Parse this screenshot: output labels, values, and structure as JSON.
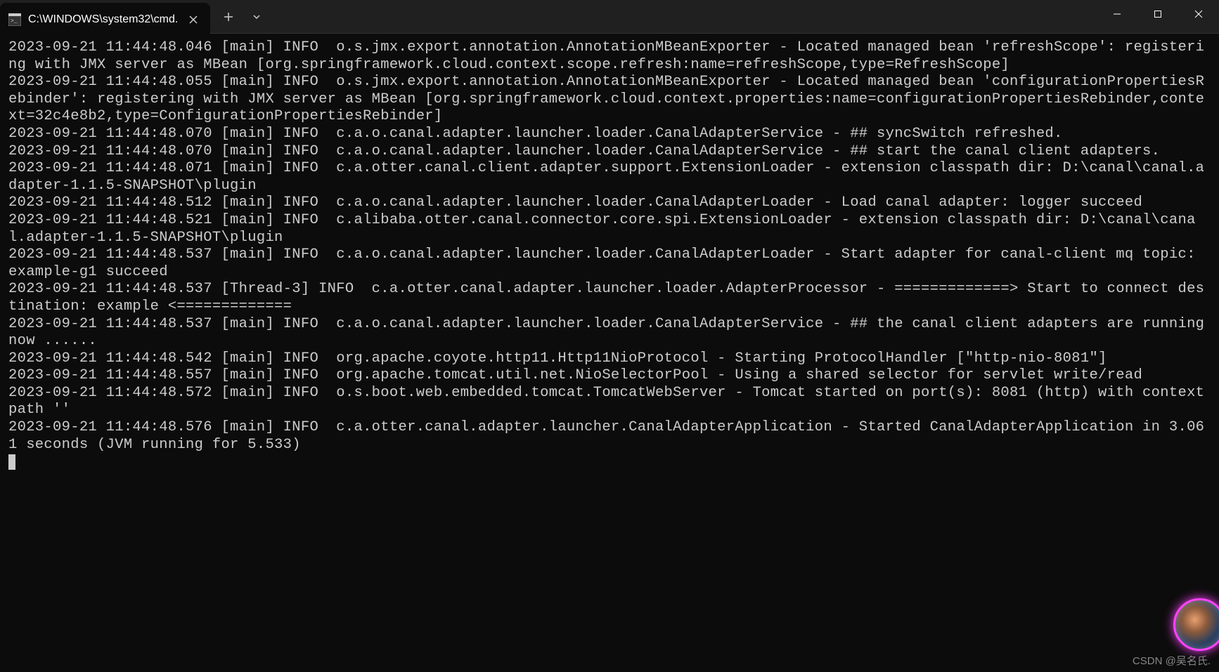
{
  "window": {
    "tab_title": "C:\\WINDOWS\\system32\\cmd."
  },
  "log_lines": [
    "2023-09-21 11:44:48.046 [main] INFO  o.s.jmx.export.annotation.AnnotationMBeanExporter - Located managed bean 'refreshScope': registering with JMX server as MBean [org.springframework.cloud.context.scope.refresh:name=refreshScope,type=RefreshScope]",
    "2023-09-21 11:44:48.055 [main] INFO  o.s.jmx.export.annotation.AnnotationMBeanExporter - Located managed bean 'configurationPropertiesRebinder': registering with JMX server as MBean [org.springframework.cloud.context.properties:name=configurationPropertiesRebinder,context=32c4e8b2,type=ConfigurationPropertiesRebinder]",
    "2023-09-21 11:44:48.070 [main] INFO  c.a.o.canal.adapter.launcher.loader.CanalAdapterService - ## syncSwitch refreshed.",
    "2023-09-21 11:44:48.070 [main] INFO  c.a.o.canal.adapter.launcher.loader.CanalAdapterService - ## start the canal client adapters.",
    "2023-09-21 11:44:48.071 [main] INFO  c.a.otter.canal.client.adapter.support.ExtensionLoader - extension classpath dir: D:\\canal\\canal.adapter-1.1.5-SNAPSHOT\\plugin",
    "2023-09-21 11:44:48.512 [main] INFO  c.a.o.canal.adapter.launcher.loader.CanalAdapterLoader - Load canal adapter: logger succeed",
    "2023-09-21 11:44:48.521 [main] INFO  c.alibaba.otter.canal.connector.core.spi.ExtensionLoader - extension classpath dir: D:\\canal\\canal.adapter-1.1.5-SNAPSHOT\\plugin",
    "2023-09-21 11:44:48.537 [main] INFO  c.a.o.canal.adapter.launcher.loader.CanalAdapterLoader - Start adapter for canal-client mq topic: example-g1 succeed",
    "2023-09-21 11:44:48.537 [Thread-3] INFO  c.a.otter.canal.adapter.launcher.loader.AdapterProcessor - =============> Start to connect destination: example <=============",
    "2023-09-21 11:44:48.537 [main] INFO  c.a.o.canal.adapter.launcher.loader.CanalAdapterService - ## the canal client adapters are running now ......",
    "2023-09-21 11:44:48.542 [main] INFO  org.apache.coyote.http11.Http11NioProtocol - Starting ProtocolHandler [\"http-nio-8081\"]",
    "2023-09-21 11:44:48.557 [main] INFO  org.apache.tomcat.util.net.NioSelectorPool - Using a shared selector for servlet write/read",
    "2023-09-21 11:44:48.572 [main] INFO  o.s.boot.web.embedded.tomcat.TomcatWebServer - Tomcat started on port(s): 8081 (http) with context path ''",
    "2023-09-21 11:44:48.576 [main] INFO  c.a.otter.canal.adapter.launcher.CanalAdapterApplication - Started CanalAdapterApplication in 3.061 seconds (JVM running for 5.533)"
  ],
  "watermark": "CSDN @吴名氏."
}
